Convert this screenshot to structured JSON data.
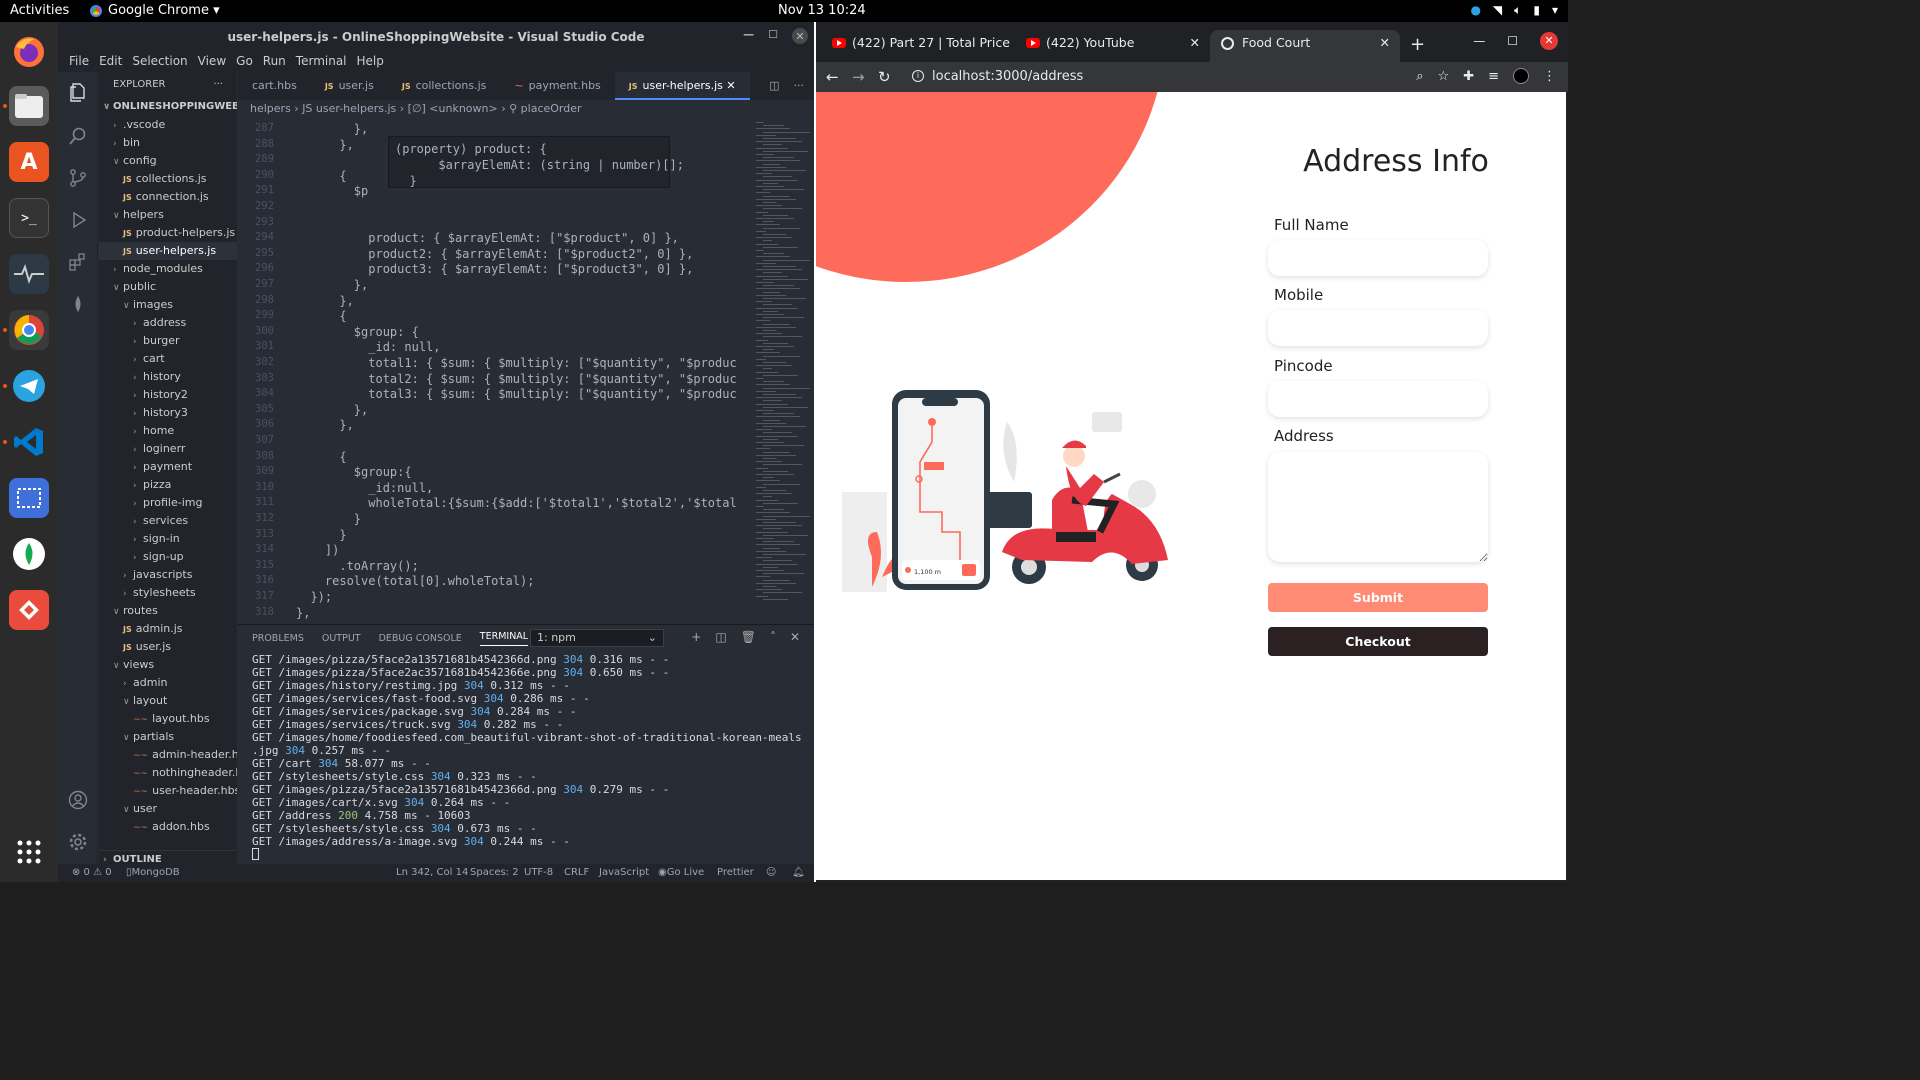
{
  "system": {
    "activities": "Activities",
    "app_name": "Google Chrome ▾",
    "clock": "Nov 13  10:24"
  },
  "vscode": {
    "title": "user-helpers.js - OnlineShoppingWebsite - Visual Studio Code",
    "menu": [
      "File",
      "Edit",
      "Selection",
      "View",
      "Go",
      "Run",
      "Terminal",
      "Help"
    ],
    "explorer_label": "EXPLORER",
    "tree": [
      {
        "label": "ONLINESHOPPINGWEBSITE",
        "indent": 0,
        "kind": "root",
        "chev": "∨"
      },
      {
        "label": ".vscode",
        "indent": 1,
        "kind": "folder",
        "chev": "›"
      },
      {
        "label": "bin",
        "indent": 1,
        "kind": "folder",
        "chev": "›"
      },
      {
        "label": "config",
        "indent": 1,
        "kind": "folder",
        "chev": "∨"
      },
      {
        "label": "collections.js",
        "indent": 2,
        "kind": "js"
      },
      {
        "label": "connection.js",
        "indent": 2,
        "kind": "js"
      },
      {
        "label": "helpers",
        "indent": 1,
        "kind": "folder",
        "chev": "∨"
      },
      {
        "label": "product-helpers.js",
        "indent": 2,
        "kind": "js"
      },
      {
        "label": "user-helpers.js",
        "indent": 2,
        "kind": "js",
        "selected": true
      },
      {
        "label": "node_modules",
        "indent": 1,
        "kind": "folder",
        "chev": "›"
      },
      {
        "label": "public",
        "indent": 1,
        "kind": "folder",
        "chev": "∨"
      },
      {
        "label": "images",
        "indent": 2,
        "kind": "folder",
        "chev": "∨"
      },
      {
        "label": "address",
        "indent": 3,
        "kind": "folder",
        "chev": "›"
      },
      {
        "label": "burger",
        "indent": 3,
        "kind": "folder",
        "chev": "›"
      },
      {
        "label": "cart",
        "indent": 3,
        "kind": "folder",
        "chev": "›"
      },
      {
        "label": "history",
        "indent": 3,
        "kind": "folder",
        "chev": "›"
      },
      {
        "label": "history2",
        "indent": 3,
        "kind": "folder",
        "chev": "›"
      },
      {
        "label": "history3",
        "indent": 3,
        "kind": "folder",
        "chev": "›"
      },
      {
        "label": "home",
        "indent": 3,
        "kind": "folder",
        "chev": "›"
      },
      {
        "label": "loginerr",
        "indent": 3,
        "kind": "folder",
        "chev": "›"
      },
      {
        "label": "payment",
        "indent": 3,
        "kind": "folder",
        "chev": "›"
      },
      {
        "label": "pizza",
        "indent": 3,
        "kind": "folder",
        "chev": "›"
      },
      {
        "label": "profile-img",
        "indent": 3,
        "kind": "folder",
        "chev": "›"
      },
      {
        "label": "services",
        "indent": 3,
        "kind": "folder",
        "chev": "›"
      },
      {
        "label": "sign-in",
        "indent": 3,
        "kind": "folder",
        "chev": "›"
      },
      {
        "label": "sign-up",
        "indent": 3,
        "kind": "folder",
        "chev": "›"
      },
      {
        "label": "javascripts",
        "indent": 2,
        "kind": "folder",
        "chev": "›"
      },
      {
        "label": "stylesheets",
        "indent": 2,
        "kind": "folder",
        "chev": "›"
      },
      {
        "label": "routes",
        "indent": 1,
        "kind": "folder",
        "chev": "∨"
      },
      {
        "label": "admin.js",
        "indent": 2,
        "kind": "js"
      },
      {
        "label": "user.js",
        "indent": 2,
        "kind": "js"
      },
      {
        "label": "views",
        "indent": 1,
        "kind": "folder",
        "chev": "∨"
      },
      {
        "label": "admin",
        "indent": 2,
        "kind": "folder",
        "chev": "›"
      },
      {
        "label": "layout",
        "indent": 2,
        "kind": "folder",
        "chev": "∨"
      },
      {
        "label": "layout.hbs",
        "indent": 3,
        "kind": "hbs"
      },
      {
        "label": "partials",
        "indent": 2,
        "kind": "folder",
        "chev": "∨"
      },
      {
        "label": "admin-header.hbs",
        "indent": 3,
        "kind": "hbs"
      },
      {
        "label": "nothingheader.hbs",
        "indent": 3,
        "kind": "hbs"
      },
      {
        "label": "user-header.hbs",
        "indent": 3,
        "kind": "hbs"
      },
      {
        "label": "user",
        "indent": 2,
        "kind": "folder",
        "chev": "∨"
      },
      {
        "label": "addon.hbs",
        "indent": 3,
        "kind": "hbs"
      }
    ],
    "outline_label": "OUTLINE",
    "tabs": [
      {
        "label": "cart.hbs",
        "kind": "hbs"
      },
      {
        "label": "user.js",
        "kind": "js"
      },
      {
        "label": "collections.js",
        "kind": "js"
      },
      {
        "label": "payment.hbs",
        "kind": "hbs"
      },
      {
        "label": "user-helpers.js",
        "kind": "js",
        "active": true
      }
    ],
    "breadcrumb": "helpers  ›  JS user-helpers.js  ›  [∅] <unknown>  ›  ⚲ placeOrder",
    "code_lines": [
      {
        "n": "287",
        "html": "        },"
      },
      {
        "n": "288",
        "html": "      },"
      },
      {
        "n": "289",
        "html": ""
      },
      {
        "n": "290",
        "html": "      {"
      },
      {
        "n": "291",
        "html": "        $p"
      },
      {
        "n": "292",
        "html": ""
      },
      {
        "n": "293",
        "html": ""
      },
      {
        "n": "294",
        "html": "          product: { $arrayElemAt: [\"$product\", 0] },"
      },
      {
        "n": "295",
        "html": "          product2: { $arrayElemAt: [\"$product2\", 0] },"
      },
      {
        "n": "296",
        "html": "          product3: { $arrayElemAt: [\"$product3\", 0] },"
      },
      {
        "n": "297",
        "html": "        },"
      },
      {
        "n": "298",
        "html": "      },"
      },
      {
        "n": "299",
        "html": "      {"
      },
      {
        "n": "300",
        "html": "        $group: {"
      },
      {
        "n": "301",
        "html": "          _id: null,"
      },
      {
        "n": "302",
        "html": "          total1: { $sum: { $multiply: [\"$quantity\", \"$produc"
      },
      {
        "n": "303",
        "html": "          total2: { $sum: { $multiply: [\"$quantity\", \"$produc"
      },
      {
        "n": "304",
        "html": "          total3: { $sum: { $multiply: [\"$quantity\", \"$produc"
      },
      {
        "n": "305",
        "html": "        },"
      },
      {
        "n": "306",
        "html": "      },"
      },
      {
        "n": "307",
        "html": ""
      },
      {
        "n": "308",
        "html": "      {"
      },
      {
        "n": "309",
        "html": "        $group:{"
      },
      {
        "n": "310",
        "html": "          _id:null,"
      },
      {
        "n": "311",
        "html": "          wholeTotal:{$sum:{$add:['$total1','$total2','$total"
      },
      {
        "n": "312",
        "html": "        }"
      },
      {
        "n": "313",
        "html": "      }"
      },
      {
        "n": "314",
        "html": "    ])"
      },
      {
        "n": "315",
        "html": "      .toArray();"
      },
      {
        "n": "316",
        "html": "    resolve(total[0].wholeTotal);"
      },
      {
        "n": "317",
        "html": "  });"
      },
      {
        "n": "318",
        "html": "},"
      }
    ],
    "hover_text": "(property) product: {\n      $arrayElemAt: (string | number)[];\n  }",
    "panel_tabs": [
      "PROBLEMS",
      "OUTPUT",
      "DEBUG CONSOLE",
      "TERMINAL"
    ],
    "terminal_select": "1: npm",
    "terminal_lines": [
      {
        "pre": "GET /images/pizza/5face2a13571681b4542366d.png ",
        "status": "304",
        "post": " 0.316 ms - -"
      },
      {
        "pre": "GET /images/pizza/5face2ac3571681b4542366e.png ",
        "status": "304",
        "post": " 0.650 ms - -"
      },
      {
        "pre": "GET /images/history/restimg.jpg ",
        "status": "304",
        "post": " 0.312 ms - -"
      },
      {
        "pre": "GET /images/services/fast-food.svg ",
        "status": "304",
        "post": " 0.286 ms - -"
      },
      {
        "pre": "GET /images/services/package.svg ",
        "status": "304",
        "post": " 0.284 ms - -"
      },
      {
        "pre": "GET /images/services/truck.svg ",
        "status": "304",
        "post": " 0.282 ms - -"
      },
      {
        "pre": "GET /images/home/foodiesfeed.com_beautiful-vibrant-shot-of-traditional-korean-meals",
        "status": "",
        "post": ""
      },
      {
        "pre": ".jpg ",
        "status": "304",
        "post": " 0.257 ms - -"
      },
      {
        "pre": "GET /cart ",
        "status": "304",
        "post": " 58.077 ms - -"
      },
      {
        "pre": "GET /stylesheets/style.css ",
        "status": "304",
        "post": " 0.323 ms - -"
      },
      {
        "pre": "GET /images/pizza/5face2a13571681b4542366d.png ",
        "status": "304",
        "post": " 0.279 ms - -"
      },
      {
        "pre": "GET /images/cart/x.svg ",
        "status": "304",
        "post": " 0.264 ms - -"
      },
      {
        "pre": "GET /address ",
        "status": "200",
        "post": " 4.758 ms - 10603"
      },
      {
        "pre": "GET /stylesheets/style.css ",
        "status": "304",
        "post": " 0.673 ms - -"
      },
      {
        "pre": "GET /images/address/a-image.svg ",
        "status": "304",
        "post": " 0.244 ms - -"
      }
    ],
    "status": {
      "problems": "⊗ 0 ⚠ 0",
      "mongodb": "MongoDB",
      "cursor": "Ln 342, Col 14",
      "spaces": "Spaces: 2",
      "encoding": "UTF-8",
      "eol": "CRLF",
      "language": "JavaScript",
      "golive": "Go Live",
      "prettier": "Prettier"
    }
  },
  "chrome": {
    "tabs": [
      {
        "label": "(422) Part 27 | Total Price",
        "kind": "youtube"
      },
      {
        "label": "(422) YouTube",
        "kind": "youtube"
      },
      {
        "label": "Food Court",
        "kind": "site",
        "active": true
      }
    ],
    "url": "localhost:3000/address",
    "page": {
      "heading": "Address Info",
      "fields": [
        {
          "label": "Full Name",
          "type": "input",
          "value": ""
        },
        {
          "label": "Mobile",
          "type": "input",
          "value": ""
        },
        {
          "label": "Pincode",
          "type": "input",
          "value": ""
        },
        {
          "label": "Address",
          "type": "textarea",
          "value": ""
        }
      ],
      "submit_label": "Submit",
      "checkout_label": "Checkout",
      "illustration_distance": "1,100 m",
      "colors": {
        "accent": "#ff6b5b",
        "submit": "#ff8b75",
        "checkout": "#2b2022"
      }
    }
  }
}
